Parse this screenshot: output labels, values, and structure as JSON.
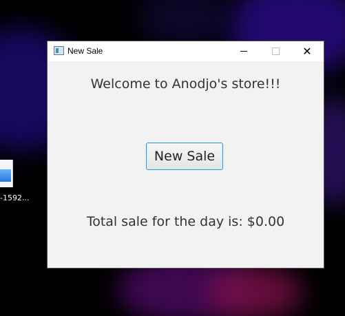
{
  "desktop": {
    "icon_label": "-1592..."
  },
  "window": {
    "title": "New Sale",
    "welcome_text": "Welcome to Anodjo's store!!!",
    "new_sale_label": "New Sale",
    "total_label": "Total sale for the day is: $0.00"
  },
  "titlebar": {
    "close_glyph": "✕"
  },
  "colors": {
    "window_bg": "#f2f2f2",
    "button_border": "#3a9ad9",
    "text": "#333333"
  }
}
